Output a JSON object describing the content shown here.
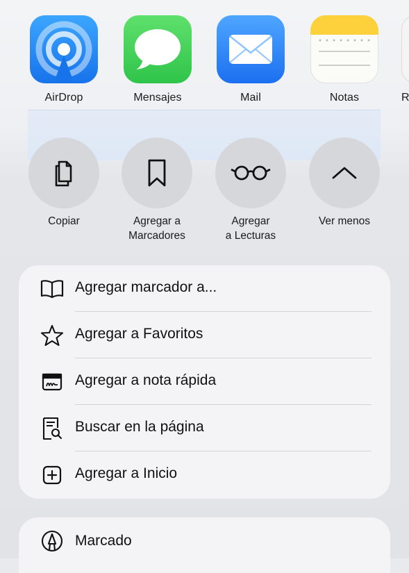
{
  "apps": [
    {
      "label": "AirDrop"
    },
    {
      "label": "Mensajes"
    },
    {
      "label": "Mail"
    },
    {
      "label": "Notas"
    },
    {
      "label": "R"
    }
  ],
  "actions": [
    {
      "line1": "Copiar",
      "line2": ""
    },
    {
      "line1": "Agregar a",
      "line2": "Marcadores"
    },
    {
      "line1": "Agregar",
      "line2": "a Lecturas"
    },
    {
      "line1": "Ver menos",
      "line2": ""
    }
  ],
  "menu": [
    {
      "label": "Agregar marcador a...",
      "icon": "book-icon"
    },
    {
      "label": "Agregar a Favoritos",
      "icon": "star-icon"
    },
    {
      "label": "Agregar a nota rápida",
      "icon": "quick-note-icon"
    },
    {
      "label": "Buscar en la página",
      "icon": "find-in-page-icon"
    },
    {
      "label": "Agregar a Inicio",
      "icon": "add-square-icon"
    }
  ],
  "bottom": {
    "label": "Marcado",
    "icon": "markup-pen-icon"
  }
}
